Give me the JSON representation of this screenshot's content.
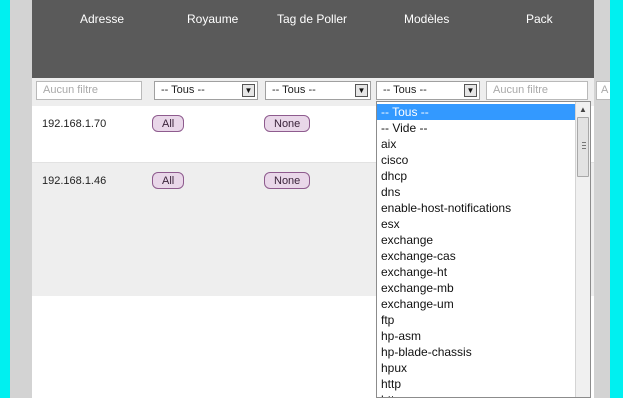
{
  "columns": [
    "Adresse",
    "Royaume",
    "Tag de Poller",
    "Modèles",
    "Pack"
  ],
  "filters": {
    "text_placeholder": "Aucun filtre",
    "clip_text": "A",
    "select_value": "-- Tous --",
    "arrow_glyph": "▼"
  },
  "rows": [
    {
      "address": "192.168.1.70",
      "realm": "All",
      "poller_tag": "None"
    },
    {
      "address": "192.168.1.46",
      "realm": "All",
      "poller_tag": "None"
    }
  ],
  "templates_dropdown": {
    "selected": "-- Tous --",
    "options": [
      "-- Tous --",
      "-- Vide --",
      "aix",
      "cisco",
      "dhcp",
      "dns",
      "enable-host-notifications",
      "esx",
      "exchange",
      "exchange-cas",
      "exchange-ht",
      "exchange-mb",
      "exchange-um",
      "ftp",
      "hp-asm",
      "hp-blade-chassis",
      "hpux",
      "http",
      "htt"
    ]
  },
  "colors": {
    "header_bg": "#5a5a5a",
    "selection": "#3399ff",
    "pill_bg": "#e9d7e9",
    "pill_border": "#8e5b8e",
    "page_bg": "#00f0f0"
  }
}
